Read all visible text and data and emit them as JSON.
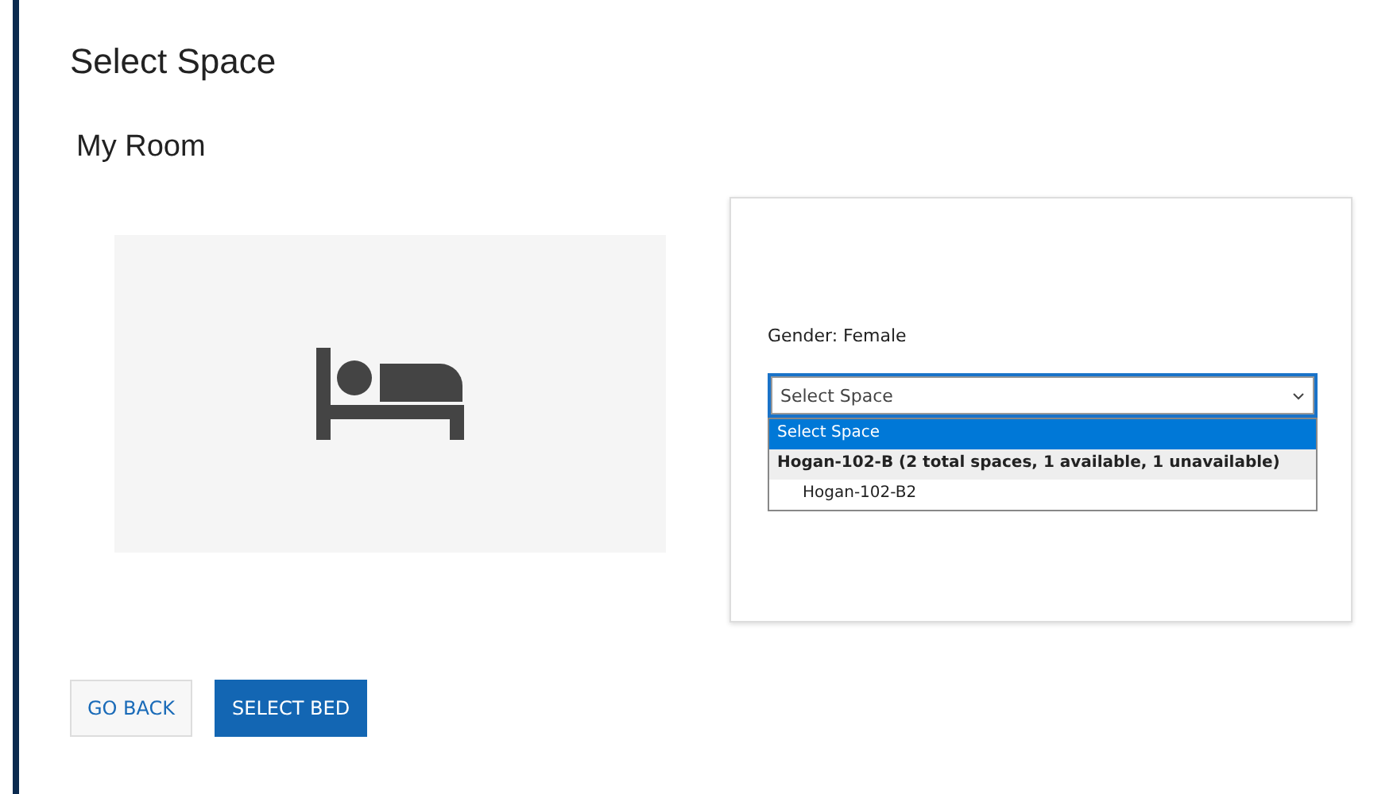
{
  "title": "Select Space",
  "room": {
    "heading": "My Room",
    "picture": {
      "kind": "bed-icon"
    }
  },
  "form": {
    "gender": "Gender: Female",
    "select": {
      "value": "Select Space",
      "expanded": true
    },
    "options": [
      {
        "kind": "option",
        "label": "Select Space",
        "selected": true
      },
      {
        "kind": "group",
        "label": "Hogan-102-B (2 total spaces, 1 available, 1 unavailable)",
        "selected": false
      },
      {
        "kind": "child",
        "label": "Hogan-102-B2",
        "selected": false
      }
    ]
  },
  "buttons": [
    {
      "kind": "secondary",
      "label": "GO BACK"
    },
    {
      "kind": "primary",
      "label": "SELECT BED"
    }
  ]
}
